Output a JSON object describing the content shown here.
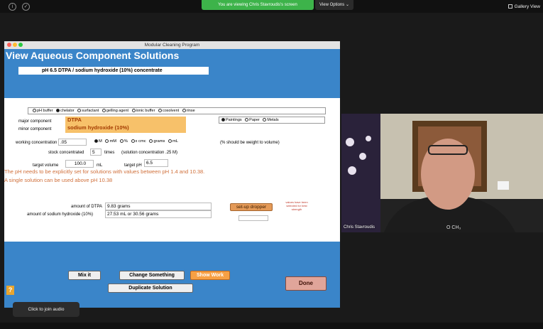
{
  "zoom": {
    "share_banner": "You are viewing Chris Stavroudis's screen",
    "view_options": "View Options ⌄",
    "gallery_view": "Gallery View",
    "participant_name": "Chris Stavroudis",
    "join_audio": "Click to join audio",
    "shirt_text": "O         CH₃"
  },
  "app": {
    "window_title": "Modular Cleaning Program",
    "title": "View Aqueous Component Solutions",
    "solution_name": "pH 6.5 DTPA / sodium hydroxide (10%)  concentrate",
    "category_options": [
      "pH buffer",
      "chelator",
      "surfactant",
      "gelling agent",
      "ionic buffer",
      "cosolvent",
      "rinse"
    ],
    "category_selected": "chelator",
    "media_options": [
      "Paintings",
      "Paper",
      "Metals"
    ],
    "media_selected": "Paintings",
    "major_component_label": "major component",
    "major_component": "DTPA",
    "minor_component_label": "minor component",
    "minor_component": "sodium hydroxide (10%)",
    "working_concentration_label": "working concentration",
    "working_concentration": ".05",
    "unit_options": [
      "M",
      "mM",
      "%",
      "x cmc",
      "grams",
      "mL"
    ],
    "unit_selected": "M",
    "weight_note": "(% should be weight to volume)",
    "stock_label": "stock concentrated",
    "stock_value": "5",
    "stock_times": "times",
    "stock_note": "(solution concentration .25 M)",
    "target_volume_label": "target volume",
    "target_volume": "100.0",
    "target_volume_unit": "mL",
    "target_ph_label": "target pH",
    "target_ph": "6.5",
    "warning_line1": "The pH needs to be explicitly set for solutions with values between pH 1.4 and 10.38.",
    "warning_line2": "A single solution can be used above pH 10.38",
    "amount_dtpa_label": "amount of DTPA",
    "amount_dtpa": "9.83 grams",
    "amount_naoh_label": "amount of sodium hydroxide (10%)",
    "amount_naoh": "27.53 mL or 30.56 grams",
    "setup_dropper": "set-up dropper",
    "dropper_note": "values have been selected for best strength",
    "mix_it": "Mix it",
    "change_something": "Change Something",
    "show_work": "Show Work",
    "duplicate_solution": "Duplicate Solution",
    "done": "Done",
    "help": "?"
  },
  "colors": {
    "app_blue": "#3a85c9",
    "orange_field": "#f7c16a",
    "warning_text": "#d0703b",
    "zoom_green": "#3db34a"
  }
}
